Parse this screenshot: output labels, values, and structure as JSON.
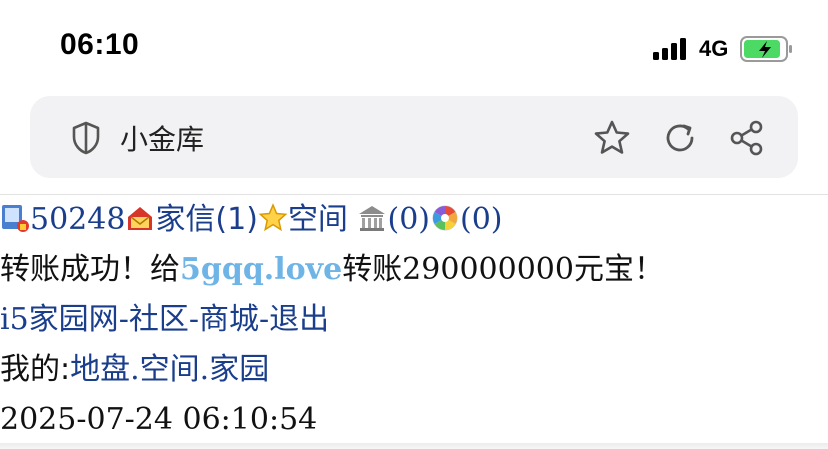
{
  "status_bar": {
    "time": "06:10",
    "network": "4G",
    "battery_level": 0.9,
    "battery_color": "#4cd964"
  },
  "address_bar": {
    "title": "小金库",
    "icons": [
      "shield-icon",
      "star-icon",
      "reload-icon",
      "share-icon"
    ]
  },
  "nav": {
    "user_id": "50248",
    "mail_label": "家信(1)",
    "space_label": "空间",
    "bank_count": "(0)",
    "album_count": "(0)"
  },
  "message": {
    "prefix": "转账成功！给",
    "recipient": "5gqq.love",
    "suffix": "转账290000000元宝！"
  },
  "links": {
    "home": "i5家园网",
    "sep1": "-",
    "community": "社区",
    "sep2": "-",
    "mall": "商城",
    "sep3": "-",
    "logout": "退出"
  },
  "mine": {
    "label": "我的:",
    "land": "地盘",
    "dot1": ".",
    "space": "空间",
    "dot2": ".",
    "home": "家园"
  },
  "timestamp": "2025-07-24 06:10:54",
  "colors": {
    "link": "#1a3e8c",
    "recipient": "#6eb4e6",
    "address_bg": "#f2f2f4"
  }
}
